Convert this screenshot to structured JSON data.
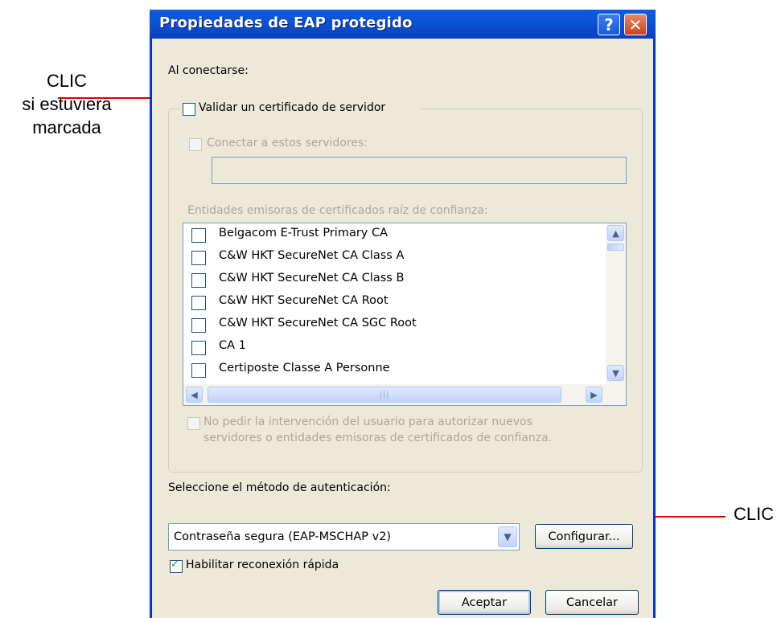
{
  "annotations": {
    "left_lines": [
      "CLIC",
      "si estuviera",
      "marcada"
    ],
    "right": "CLIC",
    "arrow_color": "#e00000"
  },
  "window": {
    "title": "Propiedades de EAP protegido",
    "help_glyph": "?",
    "close_glyph": "✕"
  },
  "dialog": {
    "on_connect_label": "Al conectarse:",
    "validate_cert": {
      "label": "Validar un certificado de servidor",
      "checked": false
    },
    "connect_servers": {
      "label": "Conectar a estos servidores:",
      "checked": false,
      "value": ""
    },
    "trusted_roots_label": "Entidades emisoras de certificados raíz de confianza:",
    "trusted_roots": [
      "Belgacom E-Trust Primary CA",
      "C&W HKT SecureNet CA Class A",
      "C&W HKT SecureNet CA Class B",
      "C&W HKT SecureNet CA Root",
      "C&W HKT SecureNet CA SGC Root",
      "CA 1",
      "Certiposte Classe A Personne"
    ],
    "no_prompt": {
      "line1": "No pedir la intervención del usuario para autorizar nuevos",
      "line2": "servidores o entidades emisoras de certificados de confianza.",
      "checked": false
    },
    "auth_method_label": "Seleccione el método de autenticación:",
    "auth_method_value": "Contraseña segura (EAP-MSCHAP v2)",
    "configure_button": "Configurar...",
    "fast_reconnect": {
      "label": "Habilitar reconexión rápida",
      "checked": true
    },
    "ok_button": "Aceptar",
    "cancel_button": "Cancelar"
  },
  "colors": {
    "titlebar": "#0a5ae0",
    "dialog_bg": "#ece9d8",
    "close_button": "#c6441c"
  }
}
